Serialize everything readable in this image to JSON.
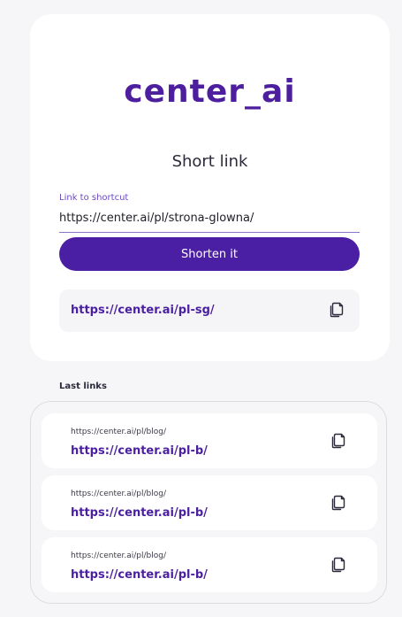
{
  "brand": {
    "logo": "center_ai",
    "color": "#4d1f9e"
  },
  "shortener": {
    "title": "Short link",
    "input_label": "Link to shortcut",
    "input_value": "https://center.ai/pl/strona-glowna/",
    "button_label": "Shorten it",
    "result_link": "https://center.ai/pl-sg/",
    "copy_icon": "copy-icon"
  },
  "last_links": {
    "label": "Last links",
    "items": [
      {
        "original": "https://center.ai/pl/blog/",
        "short": "https://center.ai/pl-b/"
      },
      {
        "original": "https://center.ai/pl/blog/",
        "short": "https://center.ai/pl-b/"
      },
      {
        "original": "https://center.ai/pl/blog/",
        "short": "https://center.ai/pl-b/"
      }
    ]
  },
  "colors": {
    "accent": "#4b1fa3",
    "link": "#4a1fa0",
    "background": "#f6f6f9"
  }
}
